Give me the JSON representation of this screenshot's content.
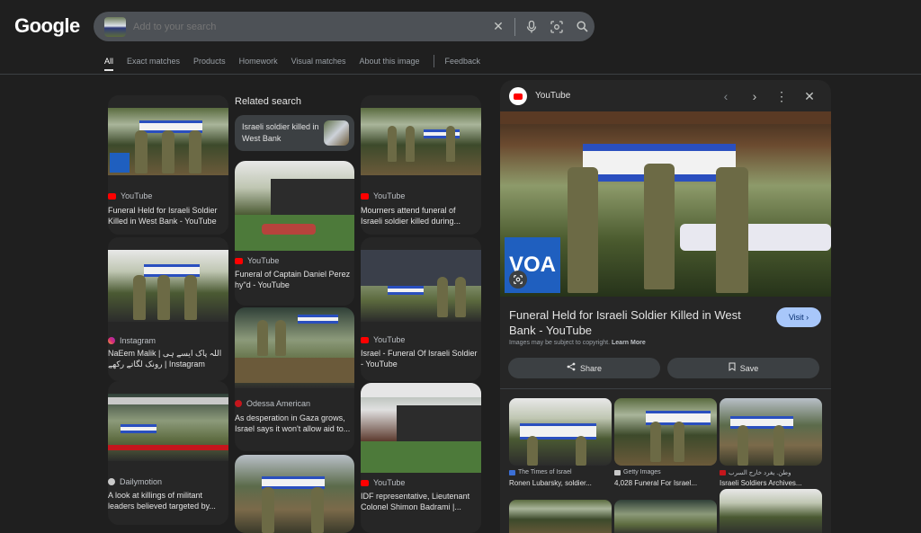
{
  "header": {
    "logo": "Google",
    "search_placeholder": "Add to your search",
    "icons": [
      "close-icon",
      "mic-icon",
      "lens-icon",
      "search-icon"
    ]
  },
  "tabs": [
    "All",
    "Exact matches",
    "Products",
    "Homework",
    "Visual matches",
    "About this image",
    "Feedback"
  ],
  "related": {
    "heading": "Related search",
    "chip": "Israeli soldier killed in West Bank"
  },
  "results": [
    {
      "source": "YouTube",
      "title": "Funeral Held for Israeli Soldier Killed in West Bank - YouTube"
    },
    {
      "source": "Instagram",
      "title": "NaEem Malik | اللہ پاک ایسے ہی رونک لگاتے رکھے | Instagram"
    },
    {
      "source": "Dailymotion",
      "title": "A look at killings of militant leaders believed targeted by..."
    },
    {
      "source": "YouTube",
      "title": "Funeral of Captain Daniel Perez hy\"d - YouTube"
    },
    {
      "source": "Odessa American",
      "title": "As desperation in Gaza grows, Israel says it won't allow aid to..."
    },
    {
      "source": "YouTube",
      "title": "Mourners attend funeral of Israeli soldier killed during..."
    },
    {
      "source": "YouTube",
      "title": "Israel - Funeral Of Israeli Soldier - YouTube"
    },
    {
      "source": "YouTube",
      "title": "IDF representative, Lieutenant Colonel Shimon Badrami |..."
    }
  ],
  "panel": {
    "source": "YouTube",
    "title": "Funeral Held for Israeli Soldier Killed in West Bank - YouTube",
    "visit_label": "Visit",
    "copyright": "Images may be subject to copyright.",
    "learn_more": "Learn More",
    "share_label": "Share",
    "save_label": "Save",
    "voa_logo": "VOA",
    "related": [
      {
        "source": "The Times of Israel",
        "title": "Ronen Lubarsky, soldier..."
      },
      {
        "source": "Getty Images",
        "title": "4,028 Funeral For Israel..."
      },
      {
        "source": "وطن. يغرد خارج السرب",
        "title": "Israeli Soldiers Archives..."
      }
    ]
  },
  "colors": {
    "background": "#1f1f1f",
    "youtube_red": "#ff0000",
    "visit_button": "#a8c7fa",
    "search_bar": "#4d5156"
  }
}
